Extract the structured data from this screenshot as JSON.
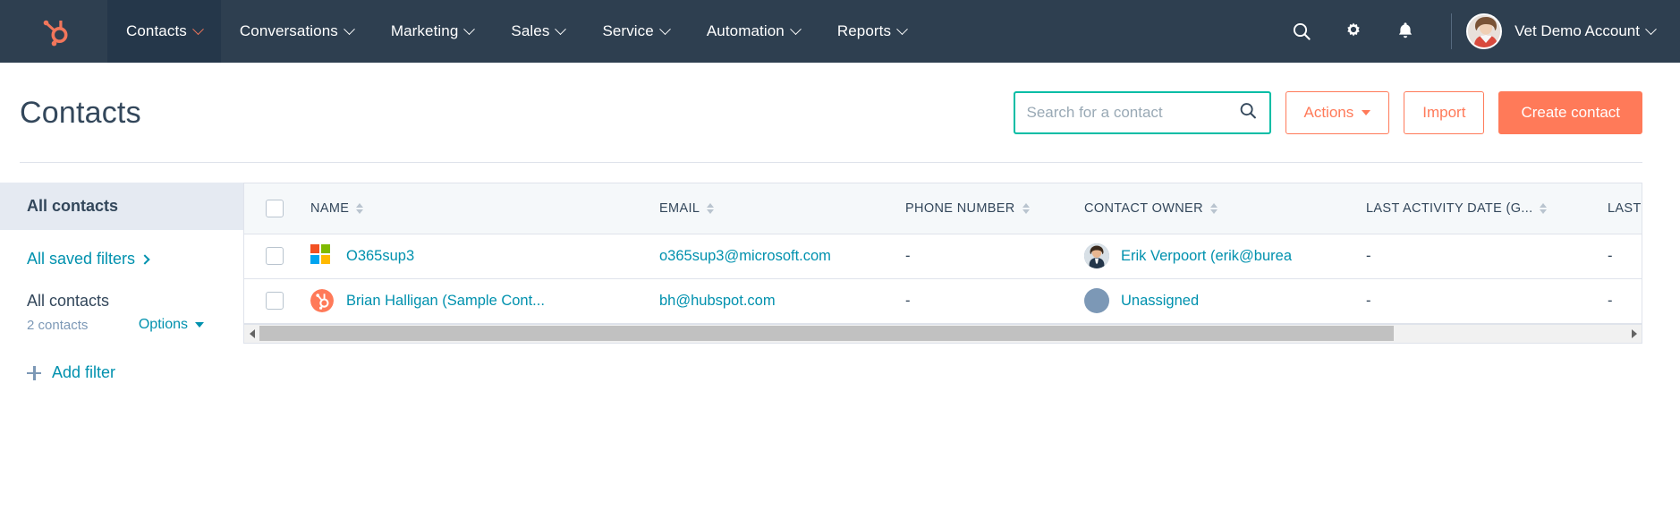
{
  "nav": {
    "logo_icon": "hubspot-sprocket-logo",
    "items": [
      {
        "label": "Contacts",
        "active": true
      },
      {
        "label": "Conversations",
        "active": false
      },
      {
        "label": "Marketing",
        "active": false
      },
      {
        "label": "Sales",
        "active": false
      },
      {
        "label": "Service",
        "active": false
      },
      {
        "label": "Automation",
        "active": false
      },
      {
        "label": "Reports",
        "active": false
      }
    ],
    "icons": [
      "search-icon",
      "gear-icon",
      "bell-icon"
    ],
    "account_name": "Vet Demo Account",
    "avatar_icon": "user-avatar-photo"
  },
  "header": {
    "title": "Contacts",
    "search": {
      "placeholder": "Search for a contact",
      "value": "",
      "icon": "search-icon"
    },
    "actions_label": "Actions",
    "import_label": "Import",
    "create_label": "Create contact"
  },
  "sidebar": {
    "all_contacts_label": "All contacts",
    "saved_filters_label": "All saved filters",
    "filter_title": "All contacts",
    "contact_count": "2 contacts",
    "options_label": "Options",
    "add_filter_label": "Add filter"
  },
  "table": {
    "columns": [
      {
        "key": "check",
        "label": ""
      },
      {
        "key": "name",
        "label": "NAME",
        "sortable": true
      },
      {
        "key": "email",
        "label": "EMAIL",
        "sortable": true
      },
      {
        "key": "phone",
        "label": "PHONE NUMBER",
        "sortable": true
      },
      {
        "key": "owner",
        "label": "CONTACT OWNER",
        "sortable": true
      },
      {
        "key": "last_activity",
        "label": "LAST ACTIVITY DATE (G...",
        "sortable": true
      },
      {
        "key": "last_contacted",
        "label": "LAST CONT",
        "sortable": true
      }
    ],
    "rows": [
      {
        "selected": false,
        "avatar_icon": "microsoft-logo",
        "name": "O365sup3",
        "email": "o365sup3@microsoft.com",
        "phone": "-",
        "owner": "Erik Verpoort (erik@burea",
        "owner_avatar_icon": "user-avatar-photo",
        "last_activity": "-",
        "last_contacted": "-"
      },
      {
        "selected": false,
        "avatar_icon": "hubspot-sprocket-logo",
        "name": "Brian Halligan (Sample Cont...",
        "email": "bh@hubspot.com",
        "phone": "-",
        "owner": "Unassigned",
        "owner_avatar_icon": "default-avatar-placeholder",
        "last_activity": "-",
        "last_contacted": "-"
      }
    ],
    "scrollbar": {
      "left_arrow_icon": "scroll-left-arrow-icon",
      "right_arrow_icon": "scroll-right-arrow-icon",
      "thumb_percent": 83
    }
  },
  "colors": {
    "nav_bg": "#2e3f50",
    "nav_active_bg": "#25374a",
    "brand_orange": "#ff7a59",
    "link_blue": "#0091ae",
    "text_dark": "#33475b",
    "focus_teal": "#00bda5",
    "header_bg": "#f5f8fa",
    "border": "#dfe3eb"
  }
}
